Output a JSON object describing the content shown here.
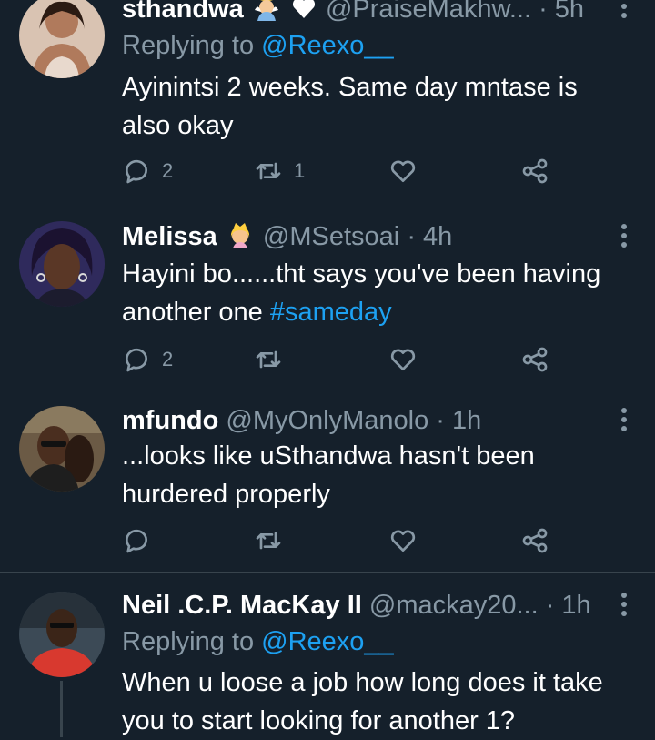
{
  "tweets": [
    {
      "name": "sthandwa",
      "handle": "@PraiseMakhw...",
      "time": "· 5h",
      "replying_prefix": "Replying to ",
      "replying_to": "@Reexo__",
      "text": "Ayinintsi 2 weeks. Same day mntase is also okay",
      "reply_count": "2",
      "retweet_count": "1",
      "like_count": "",
      "avatar_color": "#c89a7c"
    },
    {
      "name": "Melissa",
      "handle": "@MSetsoai",
      "time": "· 4h",
      "text_plain": "Hayini bo......tht says you've been having another one ",
      "hashtag": "#sameday",
      "reply_count": "2",
      "retweet_count": "",
      "like_count": "",
      "avatar_color": "#3a2f6b"
    },
    {
      "name": "mfundo",
      "handle": "@MyOnlyManolo",
      "time": "· 1h",
      "text": "...looks like uSthandwa hasn't been hurdered properly",
      "reply_count": "",
      "retweet_count": "",
      "like_count": "",
      "avatar_color": "#5a4536"
    },
    {
      "name": "Neil .C.P. MacKay II",
      "handle": "@mackay20...",
      "time": "· 1h",
      "replying_prefix": "Replying to ",
      "replying_to": "@Reexo__",
      "text": "When u loose a job how long does it take you to start looking for another 1?",
      "avatar_color": "#4d6273"
    }
  ],
  "colors": {
    "background": "#15202b",
    "secondary_text": "#8899a6",
    "link": "#1da1f2",
    "divider": "#38444d"
  },
  "icons": [
    "reply-icon",
    "retweet-icon",
    "like-icon",
    "share-icon",
    "more-icon"
  ]
}
